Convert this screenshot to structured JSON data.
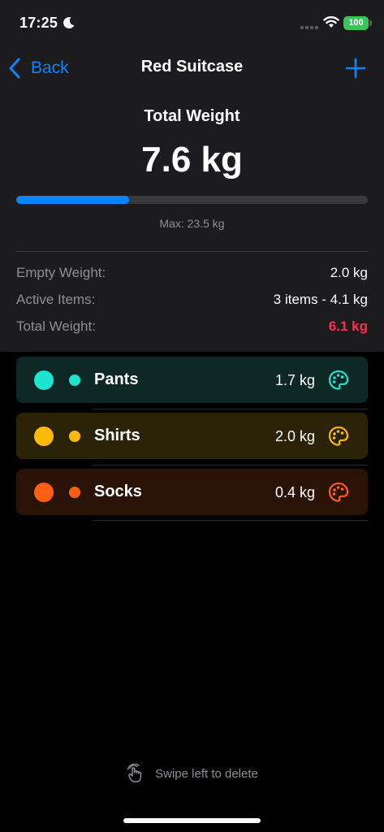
{
  "status_bar": {
    "time": "17:25",
    "battery": "100",
    "icons": [
      "moon-icon",
      "signal-icon",
      "wifi-icon",
      "battery-icon"
    ]
  },
  "nav": {
    "back_label": "Back",
    "title": "Red Suitcase",
    "back_icon": "chevron-left-icon",
    "add_icon": "plus-icon",
    "accent_color": "#0a84ff"
  },
  "summary": {
    "total_label": "Total Weight",
    "total_value": "7.6 kg",
    "progress_fraction": 0.32,
    "max_label": "Max: 23.5 kg"
  },
  "stats": [
    {
      "label": "Empty Weight:",
      "value": "2.0 kg",
      "alert": false
    },
    {
      "label": "Active Items:",
      "value": "3 items - 4.1 kg",
      "alert": false
    },
    {
      "label": "Total Weight:",
      "value": "6.1 kg",
      "alert": true
    }
  ],
  "items": [
    {
      "name": "Pants",
      "weight": "1.7 kg",
      "color": "#1ee3cf",
      "bg": "#0e2826",
      "icon": "palette-icon"
    },
    {
      "name": "Shirts",
      "weight": "2.0 kg",
      "color": "#fdb90a",
      "bg": "#2b2308",
      "icon": "palette-icon"
    },
    {
      "name": "Socks",
      "weight": "0.4 kg",
      "color": "#ff5e14",
      "bg": "#2a1207",
      "icon": "palette-icon"
    }
  ],
  "footer": {
    "hint": "Swipe left to delete",
    "hint_icon": "hand-swipe-icon"
  }
}
